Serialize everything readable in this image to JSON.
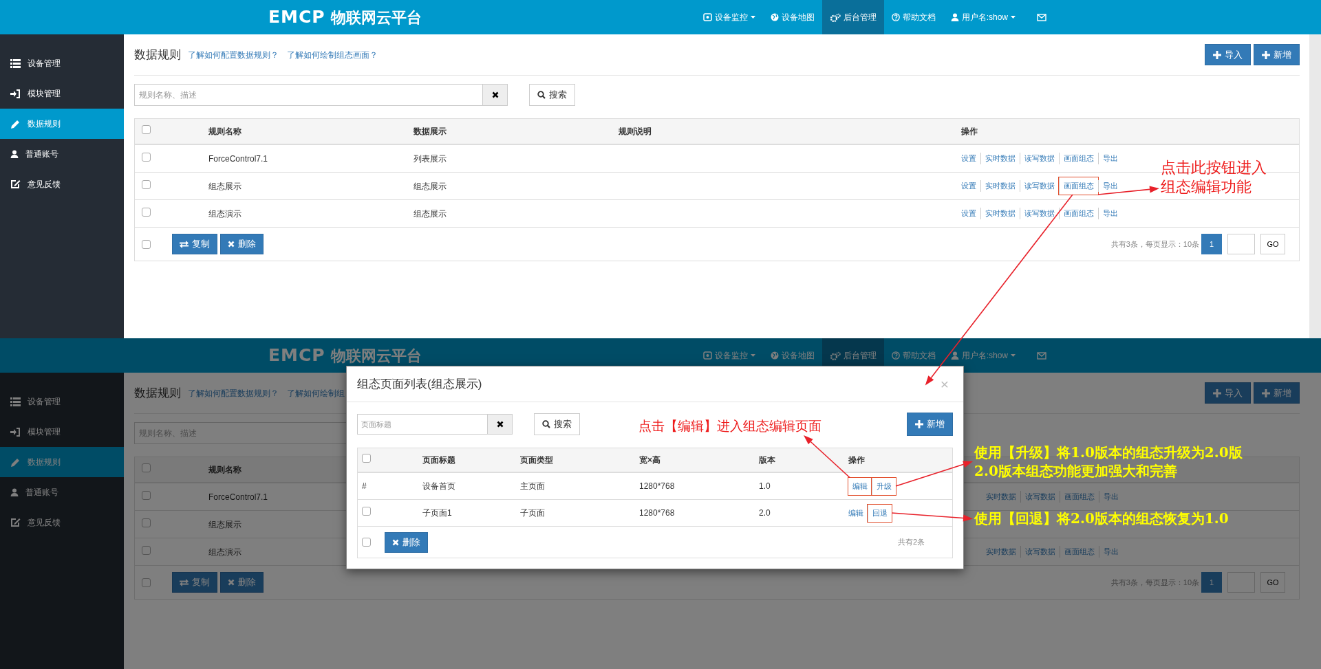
{
  "screens": [
    {
      "navbar": {
        "logo": "EMCP",
        "brand": "物联网云平台",
        "items": [
          {
            "label": "设备监控",
            "selected": false,
            "caret": true
          },
          {
            "label": "设备地图",
            "selected": false,
            "caret": false
          },
          {
            "label": "后台管理",
            "selected": true,
            "caret": false
          },
          {
            "label": "帮助文档",
            "selected": false,
            "caret": false
          },
          {
            "label": "用户名:show",
            "selected": false,
            "caret": true
          }
        ]
      },
      "sidebar": {
        "items": [
          {
            "label": "设备管理",
            "selected": false
          },
          {
            "label": "模块管理",
            "selected": false
          },
          {
            "label": "数据规则",
            "selected": true
          },
          {
            "label": "普通账号",
            "selected": false
          },
          {
            "label": "意见反馈",
            "selected": false
          }
        ]
      },
      "page": {
        "title": "数据规则",
        "links": [
          "了解如何配置数据规则？",
          "了解如何绘制组态画面？"
        ],
        "buttons": [
          "导入",
          "新增"
        ],
        "search": {
          "placeholder": "规则名称、描述",
          "button": "搜索"
        },
        "table": {
          "header_checked": false,
          "columns": [
            "规则名称",
            "数据展示",
            "规则说明",
            "操作"
          ],
          "rows": [
            {
              "checked": false,
              "name": "ForceControl7.1",
              "display": "列表展示",
              "actions": [
                {
                  "label": "设置",
                  "highlighted": false
                },
                {
                  "label": "实时数据",
                  "highlighted": false
                },
                {
                  "label": "读写数据",
                  "highlighted": false
                },
                {
                  "label": "画面组态",
                  "highlighted": false
                },
                {
                  "label": "导出",
                  "highlighted": false
                }
              ]
            },
            {
              "checked": false,
              "name": "组态展示",
              "display": "组态展示",
              "actions": [
                {
                  "label": "设置",
                  "highlighted": false
                },
                {
                  "label": "实时数据",
                  "highlighted": false
                },
                {
                  "label": "读写数据",
                  "highlighted": false
                },
                {
                  "label": "画面组态",
                  "highlighted": true
                },
                {
                  "label": "导出",
                  "highlighted": false
                }
              ]
            },
            {
              "checked": false,
              "name": "组态演示",
              "display": "组态展示",
              "actions": [
                {
                  "label": "设置",
                  "highlighted": false
                },
                {
                  "label": "实时数据",
                  "highlighted": false
                },
                {
                  "label": "读写数据",
                  "highlighted": false
                },
                {
                  "label": "画面组态",
                  "highlighted": false
                },
                {
                  "label": "导出",
                  "highlighted": false
                }
              ]
            }
          ],
          "footer": {
            "checked": false,
            "buttons": [
              "复制",
              "删除"
            ],
            "summary": "共有3条，每页显示：10条",
            "pages": [
              {
                "label": "1",
                "selected": true
              }
            ],
            "go": "GO"
          }
        }
      }
    },
    {
      "navbar": {
        "logo": "EMCP",
        "brand": "物联网云平台",
        "items": [
          {
            "label": "设备监控",
            "selected": false,
            "caret": true
          },
          {
            "label": "设备地图",
            "selected": false,
            "caret": false
          },
          {
            "label": "后台管理",
            "selected": true,
            "caret": false
          },
          {
            "label": "帮助文档",
            "selected": false,
            "caret": false
          },
          {
            "label": "用户名:show",
            "selected": false,
            "caret": true
          }
        ]
      },
      "sidebar": {
        "items": [
          {
            "label": "设备管理",
            "selected": false
          },
          {
            "label": "模块管理",
            "selected": false
          },
          {
            "label": "数据规则",
            "selected": true
          },
          {
            "label": "普通账号",
            "selected": false
          },
          {
            "label": "意见反馈",
            "selected": false
          }
        ]
      },
      "page": {
        "title": "数据规则",
        "links": [
          "了解如何配置数据规则？",
          "了解如何绘制组"
        ],
        "buttons": [
          "导入",
          "新增"
        ],
        "search": {
          "placeholder": "规则名称、描述"
        },
        "table": {
          "header_checked": false,
          "columns": [
            "规则名称"
          ],
          "rows": [
            {
              "checked": false,
              "name": "ForceControl7.1",
              "actions": [
                {
                  "label": "实时数据",
                  "highlighted": false
                },
                {
                  "label": "读写数据",
                  "highlighted": false
                },
                {
                  "label": "画面组态",
                  "highlighted": false
                },
                {
                  "label": "导出",
                  "highlighted": false
                }
              ]
            },
            {
              "checked": false,
              "name": "组态展示"
            },
            {
              "checked": false,
              "name": "组态演示",
              "actions": [
                {
                  "label": "实时数据",
                  "highlighted": false
                },
                {
                  "label": "读写数据",
                  "highlighted": false
                },
                {
                  "label": "画面组态",
                  "highlighted": false
                },
                {
                  "label": "导出",
                  "highlighted": false
                }
              ]
            }
          ],
          "footer": {
            "checked": false,
            "buttons": [
              "复制",
              "删除"
            ],
            "summary": "共有3条，每页显示：10条",
            "pages": [
              {
                "label": "1",
                "selected": true
              }
            ],
            "go": "GO"
          }
        }
      },
      "modal": {
        "title": "组态页面列表(组态展示)",
        "close": "×",
        "search": {
          "placeholder": "页面标题",
          "button": "搜索"
        },
        "add_button": "新增",
        "table": {
          "header_checked": false,
          "columns": [
            "页面标题",
            "页面类型",
            "宽×高",
            "版本",
            "操作"
          ],
          "rows": [
            {
              "marker": "#",
              "title": "设备首页",
              "type": "主页面",
              "size": "1280*768",
              "version": "1.0",
              "actions": [
                {
                  "label": "编辑",
                  "highlighted": true
                },
                {
                  "label": "升级",
                  "highlighted": true
                }
              ]
            },
            {
              "checked": false,
              "title": "子页面1",
              "type": "子页面",
              "size": "1280*768",
              "version": "2.0",
              "actions": [
                {
                  "label": "编辑",
                  "highlighted": false
                },
                {
                  "label": "回退",
                  "highlighted": true
                }
              ]
            }
          ],
          "footer": {
            "checked": false,
            "button": "删除",
            "summary": "共有2条"
          }
        }
      }
    }
  ],
  "annotations": [
    {
      "kind": "red",
      "lines": [
        "点击此按钮进入",
        "组态编辑功能"
      ]
    },
    {
      "kind": "red",
      "lines": [
        "点击【编辑】进入组态编辑页面"
      ]
    },
    {
      "kind": "yellow",
      "lines": [
        "使用【升级】将**1.0**版本的组态升级为**2.0**版",
        "**2.0**版本组态功能更加强大和完善"
      ]
    },
    {
      "kind": "yellow",
      "lines": [
        "使用【回退】将**2.0**版本的组态恢复为**1.0**"
      ]
    }
  ]
}
